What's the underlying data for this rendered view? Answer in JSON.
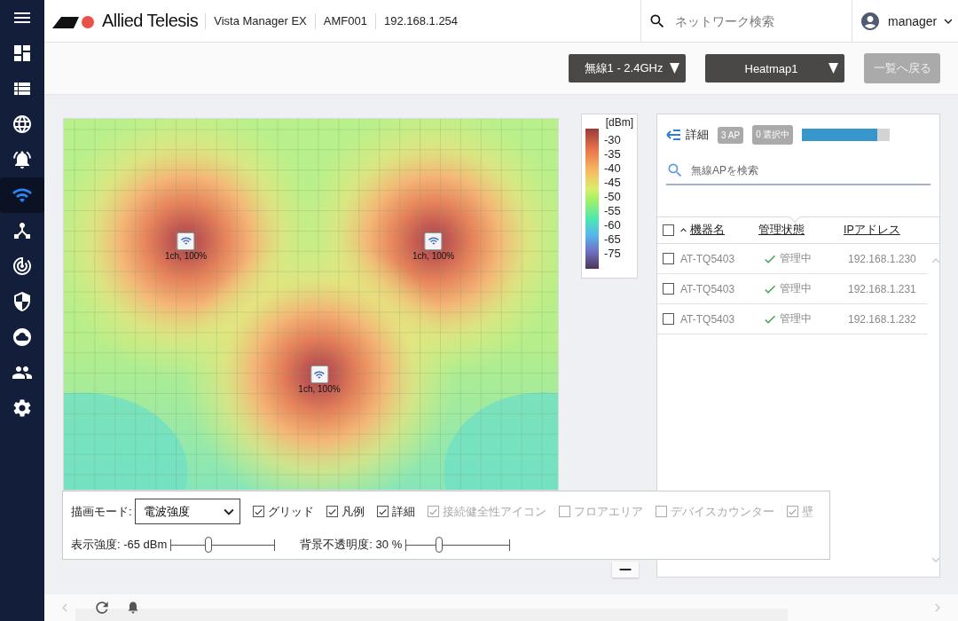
{
  "header": {
    "brand": "Allied Telesis",
    "product": "Vista Manager EX",
    "device": "AMF001",
    "address": "192.168.1.254",
    "search": {
      "placeholder": "ネットワーク検索"
    },
    "user": "manager"
  },
  "sidebar": {
    "items": [
      {
        "selected": false
      },
      {
        "selected": false
      },
      {
        "selected": false
      },
      {
        "selected": false
      },
      {
        "selected": true
      },
      {
        "selected": false
      },
      {
        "selected": false
      },
      {
        "selected": false
      },
      {
        "selected": false
      },
      {
        "selected": false
      },
      {
        "selected": false
      }
    ]
  },
  "toolbar": {
    "band_select": "無線1 - 2.4GHz",
    "heatmap_select": "Heatmap1",
    "back_button": {
      "label": "一覧へ戻る",
      "disabled": true
    }
  },
  "heatmap": {
    "access_points": [
      {
        "label": "1ch, 100%"
      },
      {
        "label": "1ch, 100%"
      },
      {
        "label": "1ch, 100%"
      }
    ]
  },
  "legend": {
    "unit": "[dBm]",
    "ticks": [
      "-30",
      "-35",
      "-40",
      "-45",
      "-50",
      "-55",
      "-60",
      "-65",
      "-75"
    ]
  },
  "detail_panel": {
    "title": "詳細",
    "ap_count": "3 AP",
    "selected_count": "0 選択中",
    "level": 0.85,
    "search": {
      "placeholder": "無線APを検索"
    },
    "columns": [
      {
        "label": "機器名",
        "sorted": true
      },
      {
        "label": "管理状態"
      },
      {
        "label": "IPアドレス"
      }
    ],
    "header_checked": false,
    "rows": [
      {
        "checked": false,
        "name": "AT-TQ5403",
        "status": "管理中",
        "ip": "192.168.1.230"
      },
      {
        "checked": false,
        "name": "AT-TQ5403",
        "status": "管理中",
        "ip": "192.168.1.231"
      },
      {
        "checked": false,
        "name": "AT-TQ5403",
        "status": "管理中",
        "ip": "192.168.1.232"
      }
    ]
  },
  "controls": {
    "mode_label": "描画モード:",
    "mode": "電波強度",
    "options": [
      {
        "label": "グリッド",
        "checked": true,
        "disabled": false
      },
      {
        "label": "凡例",
        "checked": true,
        "disabled": false
      },
      {
        "label": "詳細",
        "checked": true,
        "disabled": false
      },
      {
        "label": "接続健全性アイコン",
        "checked": true,
        "disabled": true
      },
      {
        "label": "フロアエリア",
        "checked": false,
        "disabled": true
      },
      {
        "label": "デバイスカウンター",
        "checked": false,
        "disabled": true
      },
      {
        "label": "壁",
        "checked": true,
        "disabled": true
      }
    ],
    "sliders": [
      {
        "label": "表示強度: -65 dBm",
        "level": 0.36
      },
      {
        "label": "背景不透明度: 30 %",
        "level": 0.32
      }
    ]
  }
}
